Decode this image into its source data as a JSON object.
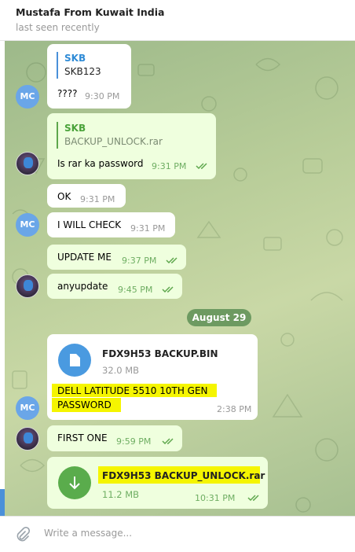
{
  "header": {
    "title": "Mustafa From Kuwait India",
    "status": "last seen recently"
  },
  "date_separator": "August 29",
  "avatars": {
    "mc_initials": "MC"
  },
  "messages": [
    {
      "sender": "MC",
      "direction": "in",
      "reply_name": "SKB",
      "reply_text": "SKB123",
      "text": "????",
      "time": "9:30 PM"
    },
    {
      "sender": "photo",
      "direction": "out",
      "reply_name": "SKB",
      "reply_text": "BACKUP_UNLOCK.rar",
      "text": "Is rar ka password",
      "time": "9:31 PM",
      "read": true
    },
    {
      "sender": "MC",
      "direction": "in",
      "text": "OK",
      "time": "9:31 PM"
    },
    {
      "sender": "MC",
      "direction": "in",
      "text": "I WILL CHECK",
      "time": "9:31 PM"
    },
    {
      "sender": "photo",
      "direction": "out",
      "text": "UPDATE ME",
      "time": "9:37 PM",
      "read": true
    },
    {
      "sender": "photo",
      "direction": "out",
      "text": "anyupdate",
      "time": "9:45 PM",
      "read": true
    },
    {
      "sender": "MC",
      "direction": "in",
      "file_name": "FDX9H53 BACKUP.BIN",
      "file_size": "32.0 MB",
      "caption_line1": "DELL LATITUDE 5510 10TH GEN",
      "caption_line2": "PASSWORD",
      "time": "2:38 PM",
      "file_icon": "document-icon"
    },
    {
      "sender": "photo",
      "direction": "out",
      "text": "FIRST ONE",
      "time": "9:59 PM",
      "read": true
    },
    {
      "sender": "photo",
      "direction": "out",
      "file_name": "FDX9H53 BACKUP_UNLOCK.rar",
      "file_size": "11.2 MB",
      "time": "10:31 PM",
      "read": true,
      "file_icon": "download-icon"
    }
  ],
  "composer": {
    "placeholder": "Write a message...",
    "attach_icon": "paperclip-icon"
  },
  "colors": {
    "accent_blue": "#4a90d9",
    "highlight": "#f5f500",
    "outgoing_bubble": "#efffde",
    "date_pill": "#6d9a61"
  }
}
